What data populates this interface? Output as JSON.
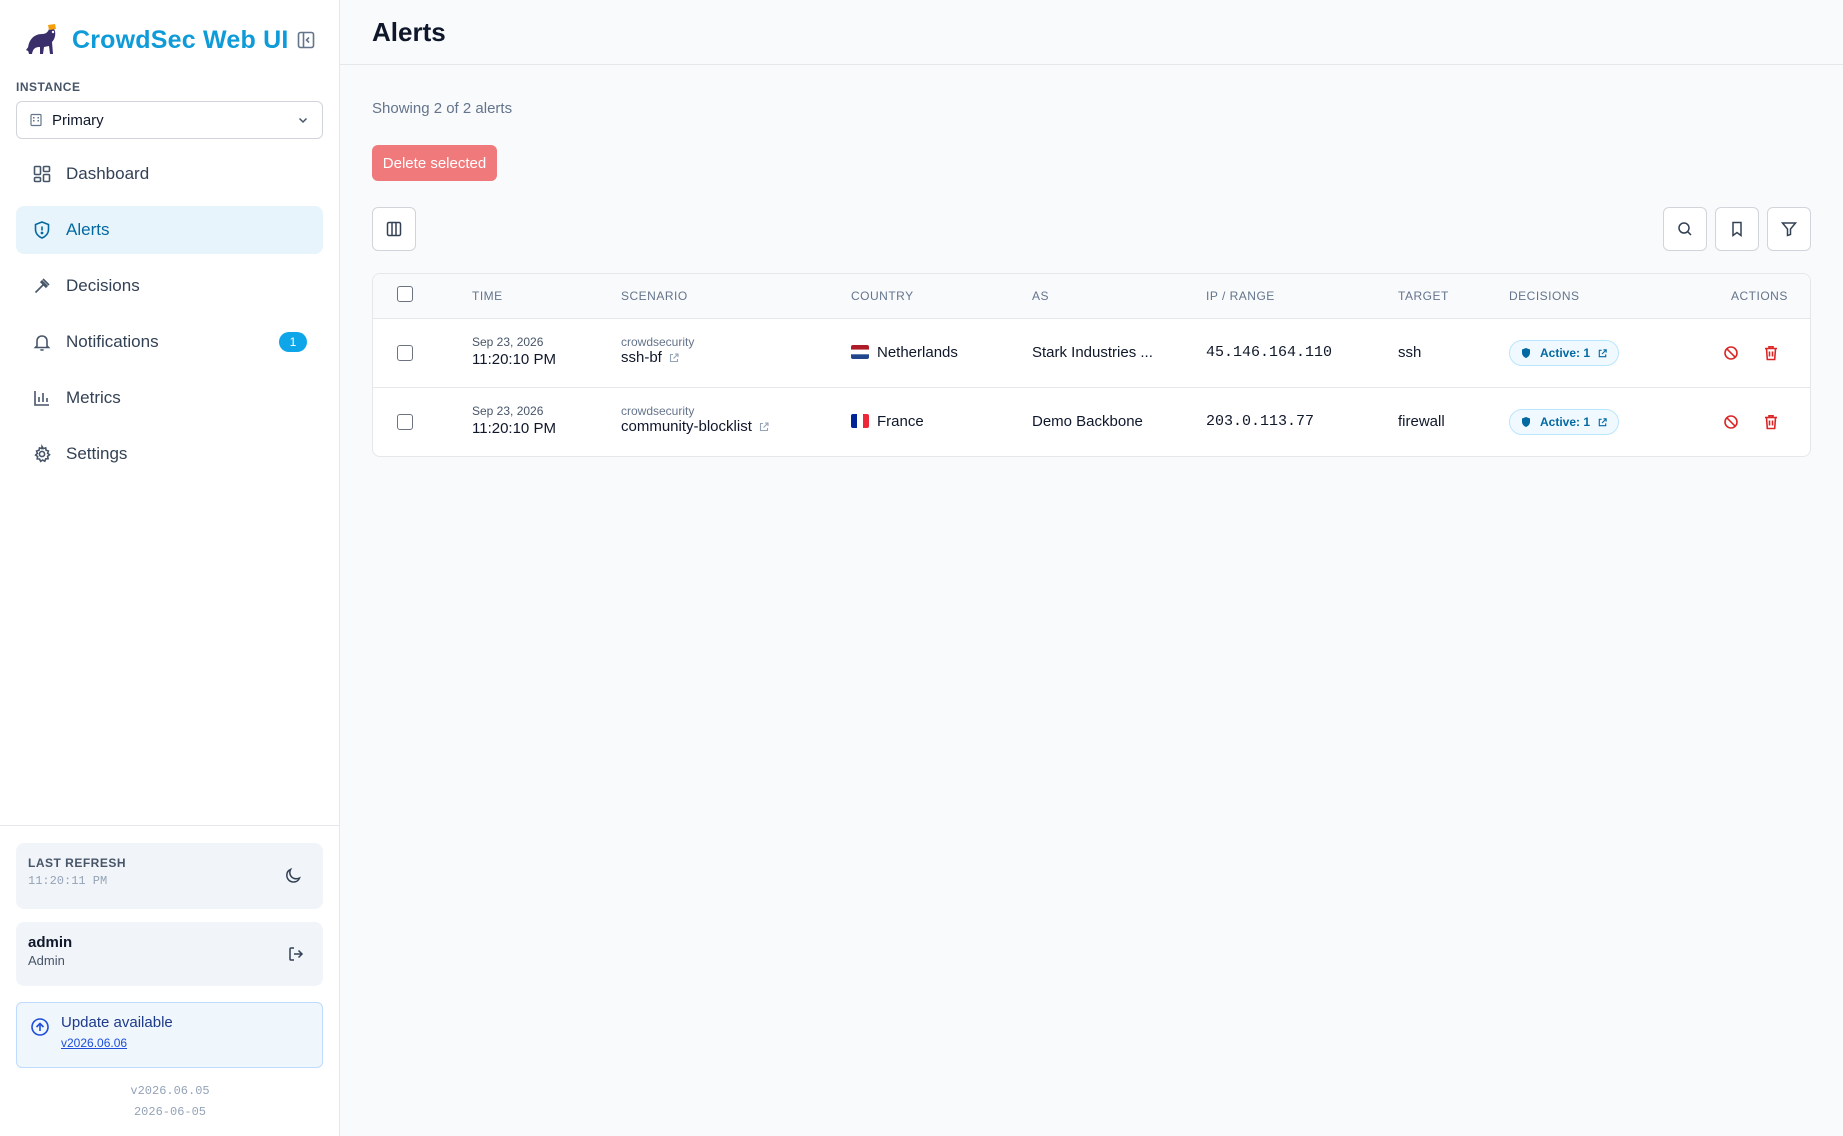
{
  "app": {
    "title": "CrowdSec Web UI",
    "accent_color": "#0e9bd8"
  },
  "sidebar": {
    "instance_label": "INSTANCE",
    "instance_value": "Primary",
    "nav": [
      {
        "label": "Dashboard",
        "icon": "dashboard-icon",
        "active": false
      },
      {
        "label": "Alerts",
        "icon": "shield-icon",
        "active": true
      },
      {
        "label": "Decisions",
        "icon": "gavel-icon",
        "active": false
      },
      {
        "label": "Notifications",
        "icon": "bell-icon",
        "active": false,
        "badge": "1"
      },
      {
        "label": "Metrics",
        "icon": "bar-chart-icon",
        "active": false
      },
      {
        "label": "Settings",
        "icon": "gear-icon",
        "active": false
      }
    ],
    "last_refresh_label": "LAST REFRESH",
    "last_refresh_time": "11:20:11 PM",
    "user_name": "admin",
    "user_role": "Admin",
    "update_title": "Update available",
    "update_version": "v2026.06.06",
    "current_version": "v2026.06.05",
    "current_date": "2026-06-05"
  },
  "page": {
    "title": "Alerts",
    "showing": "Showing 2 of 2 alerts",
    "delete_selected": "Delete selected"
  },
  "table": {
    "columns": [
      "TIME",
      "SCENARIO",
      "COUNTRY",
      "AS",
      "IP / RANGE",
      "TARGET",
      "DECISIONS",
      "ACTIONS"
    ],
    "rows": [
      {
        "date": "Sep 23, 2026",
        "time": "11:20:10 PM",
        "scenario_ns": "crowdsecurity",
        "scenario": "ssh-bf",
        "country": "Netherlands",
        "flag": "nl",
        "as": "Stark Industries ...",
        "ip": "45.146.164.110",
        "target": "ssh",
        "decisions": "Active: 1"
      },
      {
        "date": "Sep 23, 2026",
        "time": "11:20:10 PM",
        "scenario_ns": "crowdsecurity",
        "scenario": "community-blocklist",
        "country": "France",
        "flag": "fr",
        "as": "Demo Backbone",
        "ip": "203.0.113.77",
        "target": "firewall",
        "decisions": "Active: 1"
      }
    ]
  }
}
